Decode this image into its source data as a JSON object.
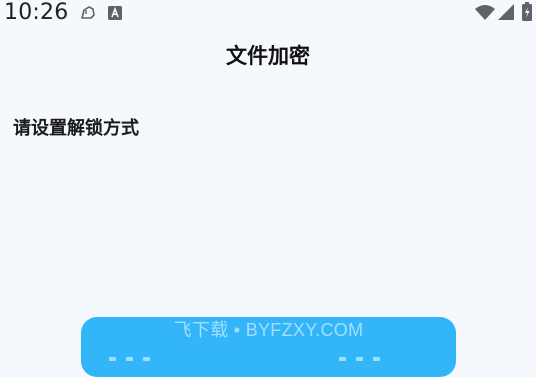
{
  "status_bar": {
    "time": "10:26",
    "icons": [
      "assistant-icon",
      "text-a-icon",
      "wifi-icon",
      "signal-icon",
      "battery-icon"
    ]
  },
  "header": {
    "title": "文件加密"
  },
  "main": {
    "section_label": "请设置解锁方式"
  },
  "bottom_card": {
    "watermark": "飞下载 • BYFZXY.COM",
    "accent": "#33b5fa"
  }
}
